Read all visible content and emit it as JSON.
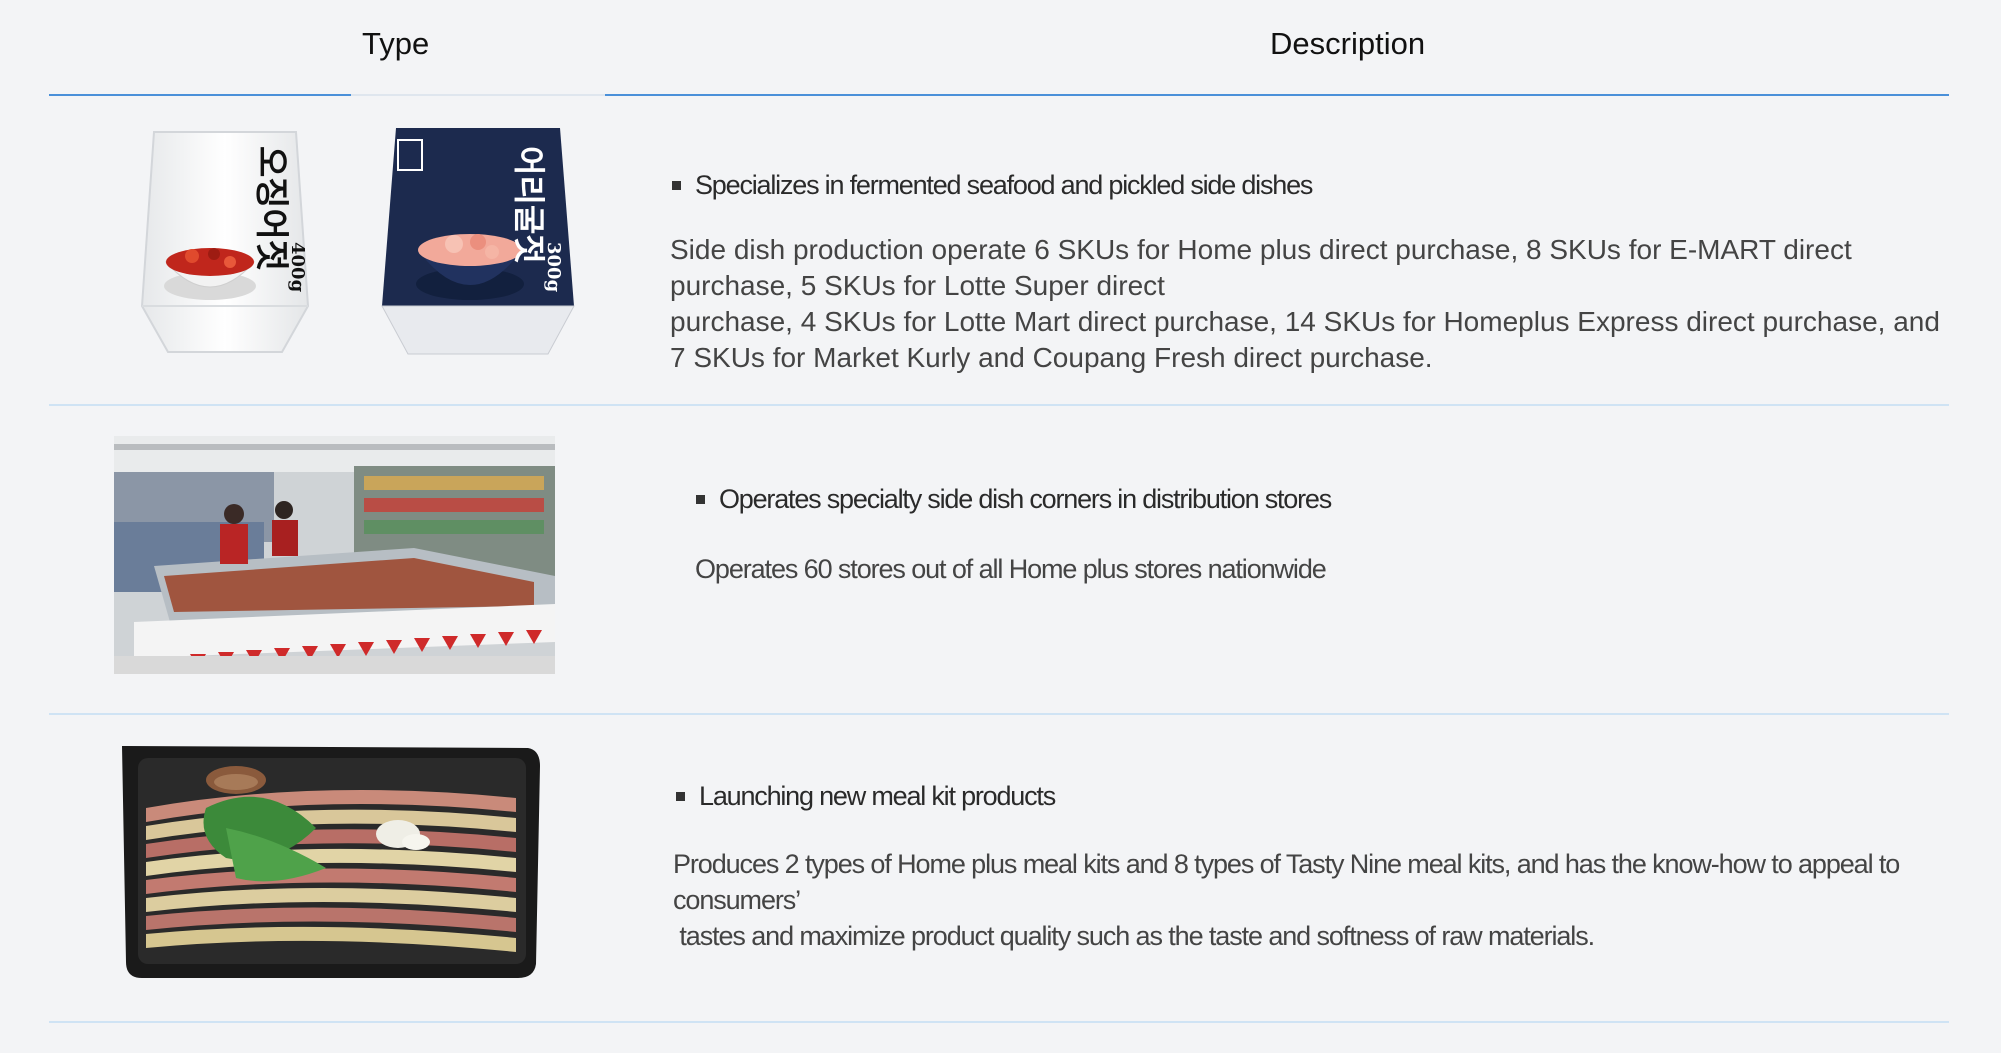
{
  "header": {
    "type_label": "Type",
    "description_label": "Description"
  },
  "rows": [
    {
      "title": "Specializes in fermented seafood and pickled side dishes",
      "description_lines": [
        "Side dish production operate 6 SKUs for Home plus direct purchase, 8 SKUs for E-MART direct",
        "purchase, 5 SKUs for Lotte Super direct",
        "purchase, 4 SKUs for Lotte Mart direct purchase, 14 SKUs for Homeplus Express direct purchase, and",
        "7 SKUs for Market Kurly and Coupang Fresh direct purchase."
      ],
      "images": [
        {
          "name": "fermented-seafood-package-white",
          "label_lines": [
            "오징어젓",
            "400g"
          ]
        },
        {
          "name": "fermented-seafood-package-navy",
          "label_lines": [
            "어리굴젓",
            "300g"
          ]
        }
      ]
    },
    {
      "title": "Operates specialty side dish corners in distribution stores",
      "description_lines": [
        "Operates 60 stores out of all Home plus stores nationwide"
      ],
      "images": [
        {
          "name": "store-side-dish-corner-photo"
        }
      ]
    },
    {
      "title": "Launching new meal kit products",
      "description_lines": [
        "Produces 2 types of Home plus meal kits and 8 types of Tasty Nine meal kits, and has the know-how to appeal to consumers’",
        " tastes and maximize product quality such as the taste and softness of raw materials."
      ],
      "images": [
        {
          "name": "meal-kit-tray-photo"
        }
      ]
    }
  ],
  "colors": {
    "background": "#f3f4f6",
    "header_rule": "#4a90d9",
    "row_divider": "#cfe3f4",
    "package_navy": "#1c2a4e"
  }
}
